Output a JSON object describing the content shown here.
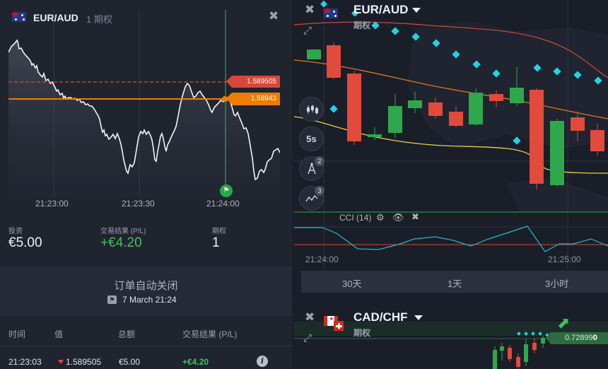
{
  "colors": {
    "green": "#3fc25c",
    "red": "#e24a3b",
    "orange": "#ef7d00",
    "cyan": "#22d3e6",
    "panel": "#20242f",
    "background": "#1a1e29"
  },
  "left_panel": {
    "pair": "EUR/AUD",
    "type_label": "1 期权",
    "close_icon": "close-icon",
    "chart": {
      "time_labels": [
        "21:23:00",
        "21:23:30",
        "21:24:00"
      ],
      "price_red": "1.589505",
      "price_orange": "1.58943",
      "expiry_icon": "checkered-flag-icon"
    },
    "stats": {
      "invest_label": "投资",
      "invest_value": "€5.00",
      "pl_label": "交易结果 (P/L)",
      "pl_value": "+€4.20",
      "options_label": "期权",
      "options_value": "1"
    },
    "auto_close": {
      "title": "订单自动关闭",
      "icon": "checkered-flag-icon",
      "date": "7 March 21:24"
    },
    "table": {
      "headers": [
        "时间",
        "值",
        "总额",
        "交易结果 (P/L)"
      ],
      "rows": [
        {
          "time": "21:23:03",
          "direction": "down",
          "value": "1.589505",
          "amount": "€5.00",
          "pl": "+€4.20"
        }
      ],
      "info_icon": "info-icon"
    }
  },
  "right_top": {
    "pair": "EUR/AUD",
    "type_label": "期权",
    "close_icon": "close-icon",
    "expand_icon": "expand-icon",
    "tools": [
      {
        "name": "chart-type-button",
        "label": "",
        "badge": ""
      },
      {
        "name": "timeframe-button",
        "label": "5s",
        "badge": ""
      },
      {
        "name": "drawing-tools-button",
        "label": "",
        "badge": "2"
      },
      {
        "name": "indicators-button",
        "label": "",
        "badge": "3"
      }
    ],
    "indicator": {
      "label": "CCI (14)",
      "gear_icon": "gear-icon",
      "eye_icon": "eye-icon",
      "close_icon": "close-icon"
    },
    "time_labels": [
      "21:24:00",
      "21:25:00"
    ],
    "timeframes": [
      "30天",
      "1天",
      "3小时"
    ]
  },
  "right_bottom": {
    "pair": "CAD/CHF",
    "type_label": "期权",
    "close_icon": "close-icon",
    "expand_icon": "expand-icon",
    "price_main": "0.72899",
    "price_last": "0",
    "arrow_icon": "arrow-up-right-icon"
  }
}
